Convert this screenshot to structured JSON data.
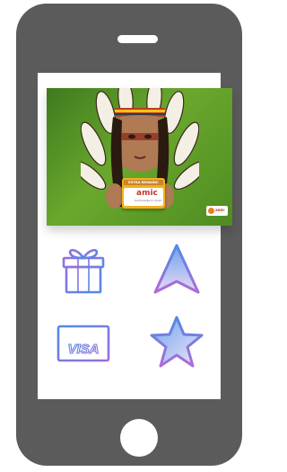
{
  "banner": {
    "card_header": "EXTRA REWARD!",
    "card_brand": "amic",
    "card_tagline": "Community in mind",
    "corner_brand": "amic"
  },
  "tiles": [
    {
      "icon": "gift-icon"
    },
    {
      "icon": "navigation-arrow-icon"
    },
    {
      "icon": "visa-card-icon",
      "label": "VISA"
    },
    {
      "icon": "star-icon"
    }
  ],
  "colors": {
    "phone_body": "#5b5b5b",
    "icon_gradient_start": "#9b6dde",
    "icon_gradient_end": "#4f8be6"
  }
}
